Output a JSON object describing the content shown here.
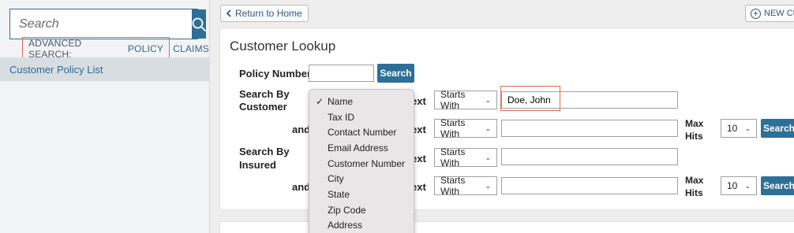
{
  "sidebar": {
    "search_placeholder": "Search",
    "advanced_label": "ADVANCED SEARCH:",
    "policy_link": "POLICY",
    "claims_link": "CLAIMS",
    "nav_item": "Customer Policy List"
  },
  "header": {
    "return_label": "Return to Home",
    "new_label": "NEW CUSTOMER"
  },
  "panel": {
    "title": "Customer Lookup",
    "policy_number_label": "Policy Number",
    "policy_number_value": "",
    "search_button": "Search",
    "search_by_customer": [
      "Search By",
      "Customer"
    ],
    "search_by_insured": [
      "Search By",
      "Insured"
    ],
    "and_label": "and",
    "text_label": "ext",
    "rows": [
      {
        "match": "Starts With",
        "value": "Doe, John"
      },
      {
        "match": "Starts With",
        "value": ""
      },
      {
        "match": "Starts With",
        "value": ""
      },
      {
        "match": "Starts With",
        "value": ""
      }
    ],
    "max_hits_label": [
      "Max",
      "Hits"
    ],
    "max_hits_value": "10",
    "search_right": "Search"
  },
  "dropdown": {
    "selected": "Name",
    "options": [
      "Name",
      "Tax ID",
      "Contact Number",
      "Email Address",
      "Customer Number",
      "City",
      "State",
      "Zip Code",
      "Address"
    ]
  }
}
